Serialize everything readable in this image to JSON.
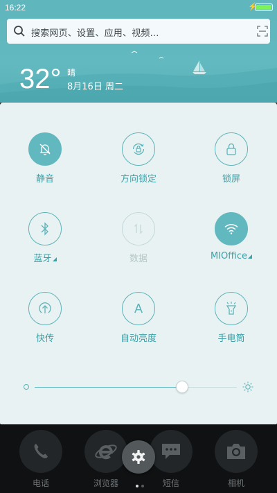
{
  "status_bar": {
    "time": "16:22",
    "battery_level": 1.0,
    "charging": true
  },
  "search": {
    "placeholder": "搜索网页、设置、应用、视频..."
  },
  "weather": {
    "temperature": "32°",
    "condition": "晴",
    "date": "8月16日 周二"
  },
  "tiles": [
    {
      "label": "静音",
      "icon": "bell-off-icon",
      "state": "on"
    },
    {
      "label": "方向锁定",
      "icon": "rotation-lock-icon",
      "state": "normal"
    },
    {
      "label": "锁屏",
      "icon": "padlock-icon",
      "state": "normal"
    },
    {
      "label": "蓝牙",
      "icon": "bluetooth-icon",
      "state": "normal",
      "has_menu": true
    },
    {
      "label": "数据",
      "icon": "mobile-data-icon",
      "state": "disabled"
    },
    {
      "label": "MIOffice",
      "icon": "wifi-icon",
      "state": "on",
      "has_menu": true
    },
    {
      "label": "快传",
      "icon": "quick-transfer-icon",
      "state": "normal"
    },
    {
      "label": "自动亮度",
      "icon": "auto-brightness-icon",
      "glyph": "A",
      "state": "normal"
    },
    {
      "label": "手电筒",
      "icon": "flashlight-icon",
      "state": "normal"
    }
  ],
  "brightness": {
    "level": 0.73
  },
  "dock": [
    {
      "label": "电话",
      "icon": "phone-icon"
    },
    {
      "label": "浏览器",
      "icon": "browser-icon"
    },
    {
      "label": "短信",
      "icon": "message-icon"
    },
    {
      "label": "相机",
      "icon": "camera-icon"
    }
  ],
  "page_indicator": {
    "count": 2,
    "active": 1
  },
  "colors": {
    "accent": "#5db3b9",
    "header": "#5fb7bd",
    "panel": "#e9f2f2"
  }
}
